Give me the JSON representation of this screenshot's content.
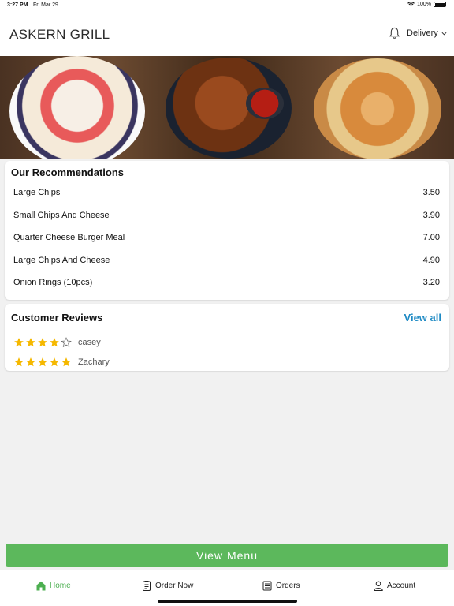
{
  "status_bar": {
    "time": "3:27 PM",
    "date": "Fri Mar 29",
    "battery": "100%"
  },
  "header": {
    "title": "ASKERN GRILL",
    "delivery_label": "Delivery"
  },
  "recommendations": {
    "title": "Our Recommendations",
    "items": [
      {
        "name": "Large Chips",
        "price": "3.50"
      },
      {
        "name": "Small Chips And Cheese",
        "price": "3.90"
      },
      {
        "name": "Quarter Cheese Burger Meal",
        "price": "7.00"
      },
      {
        "name": "Large Chips And Cheese",
        "price": "4.90"
      },
      {
        "name": "Onion Rings (10pcs)",
        "price": "3.20"
      }
    ]
  },
  "reviews": {
    "title": "Customer Reviews",
    "view_all": "View all",
    "items": [
      {
        "name": "casey",
        "rating": 4
      },
      {
        "name": "Zachary",
        "rating": 5
      }
    ]
  },
  "view_menu_label": "View Menu",
  "tabs": [
    {
      "label": "Home",
      "icon": "home-icon",
      "active": true
    },
    {
      "label": "Order Now",
      "icon": "order-icon",
      "active": false
    },
    {
      "label": "Orders",
      "icon": "receipt-icon",
      "active": false
    },
    {
      "label": "Account",
      "icon": "user-icon",
      "active": false
    }
  ],
  "colors": {
    "accent_green": "#5cb85c",
    "link_blue": "#1e8ac4",
    "star_yellow": "#f5b800"
  }
}
